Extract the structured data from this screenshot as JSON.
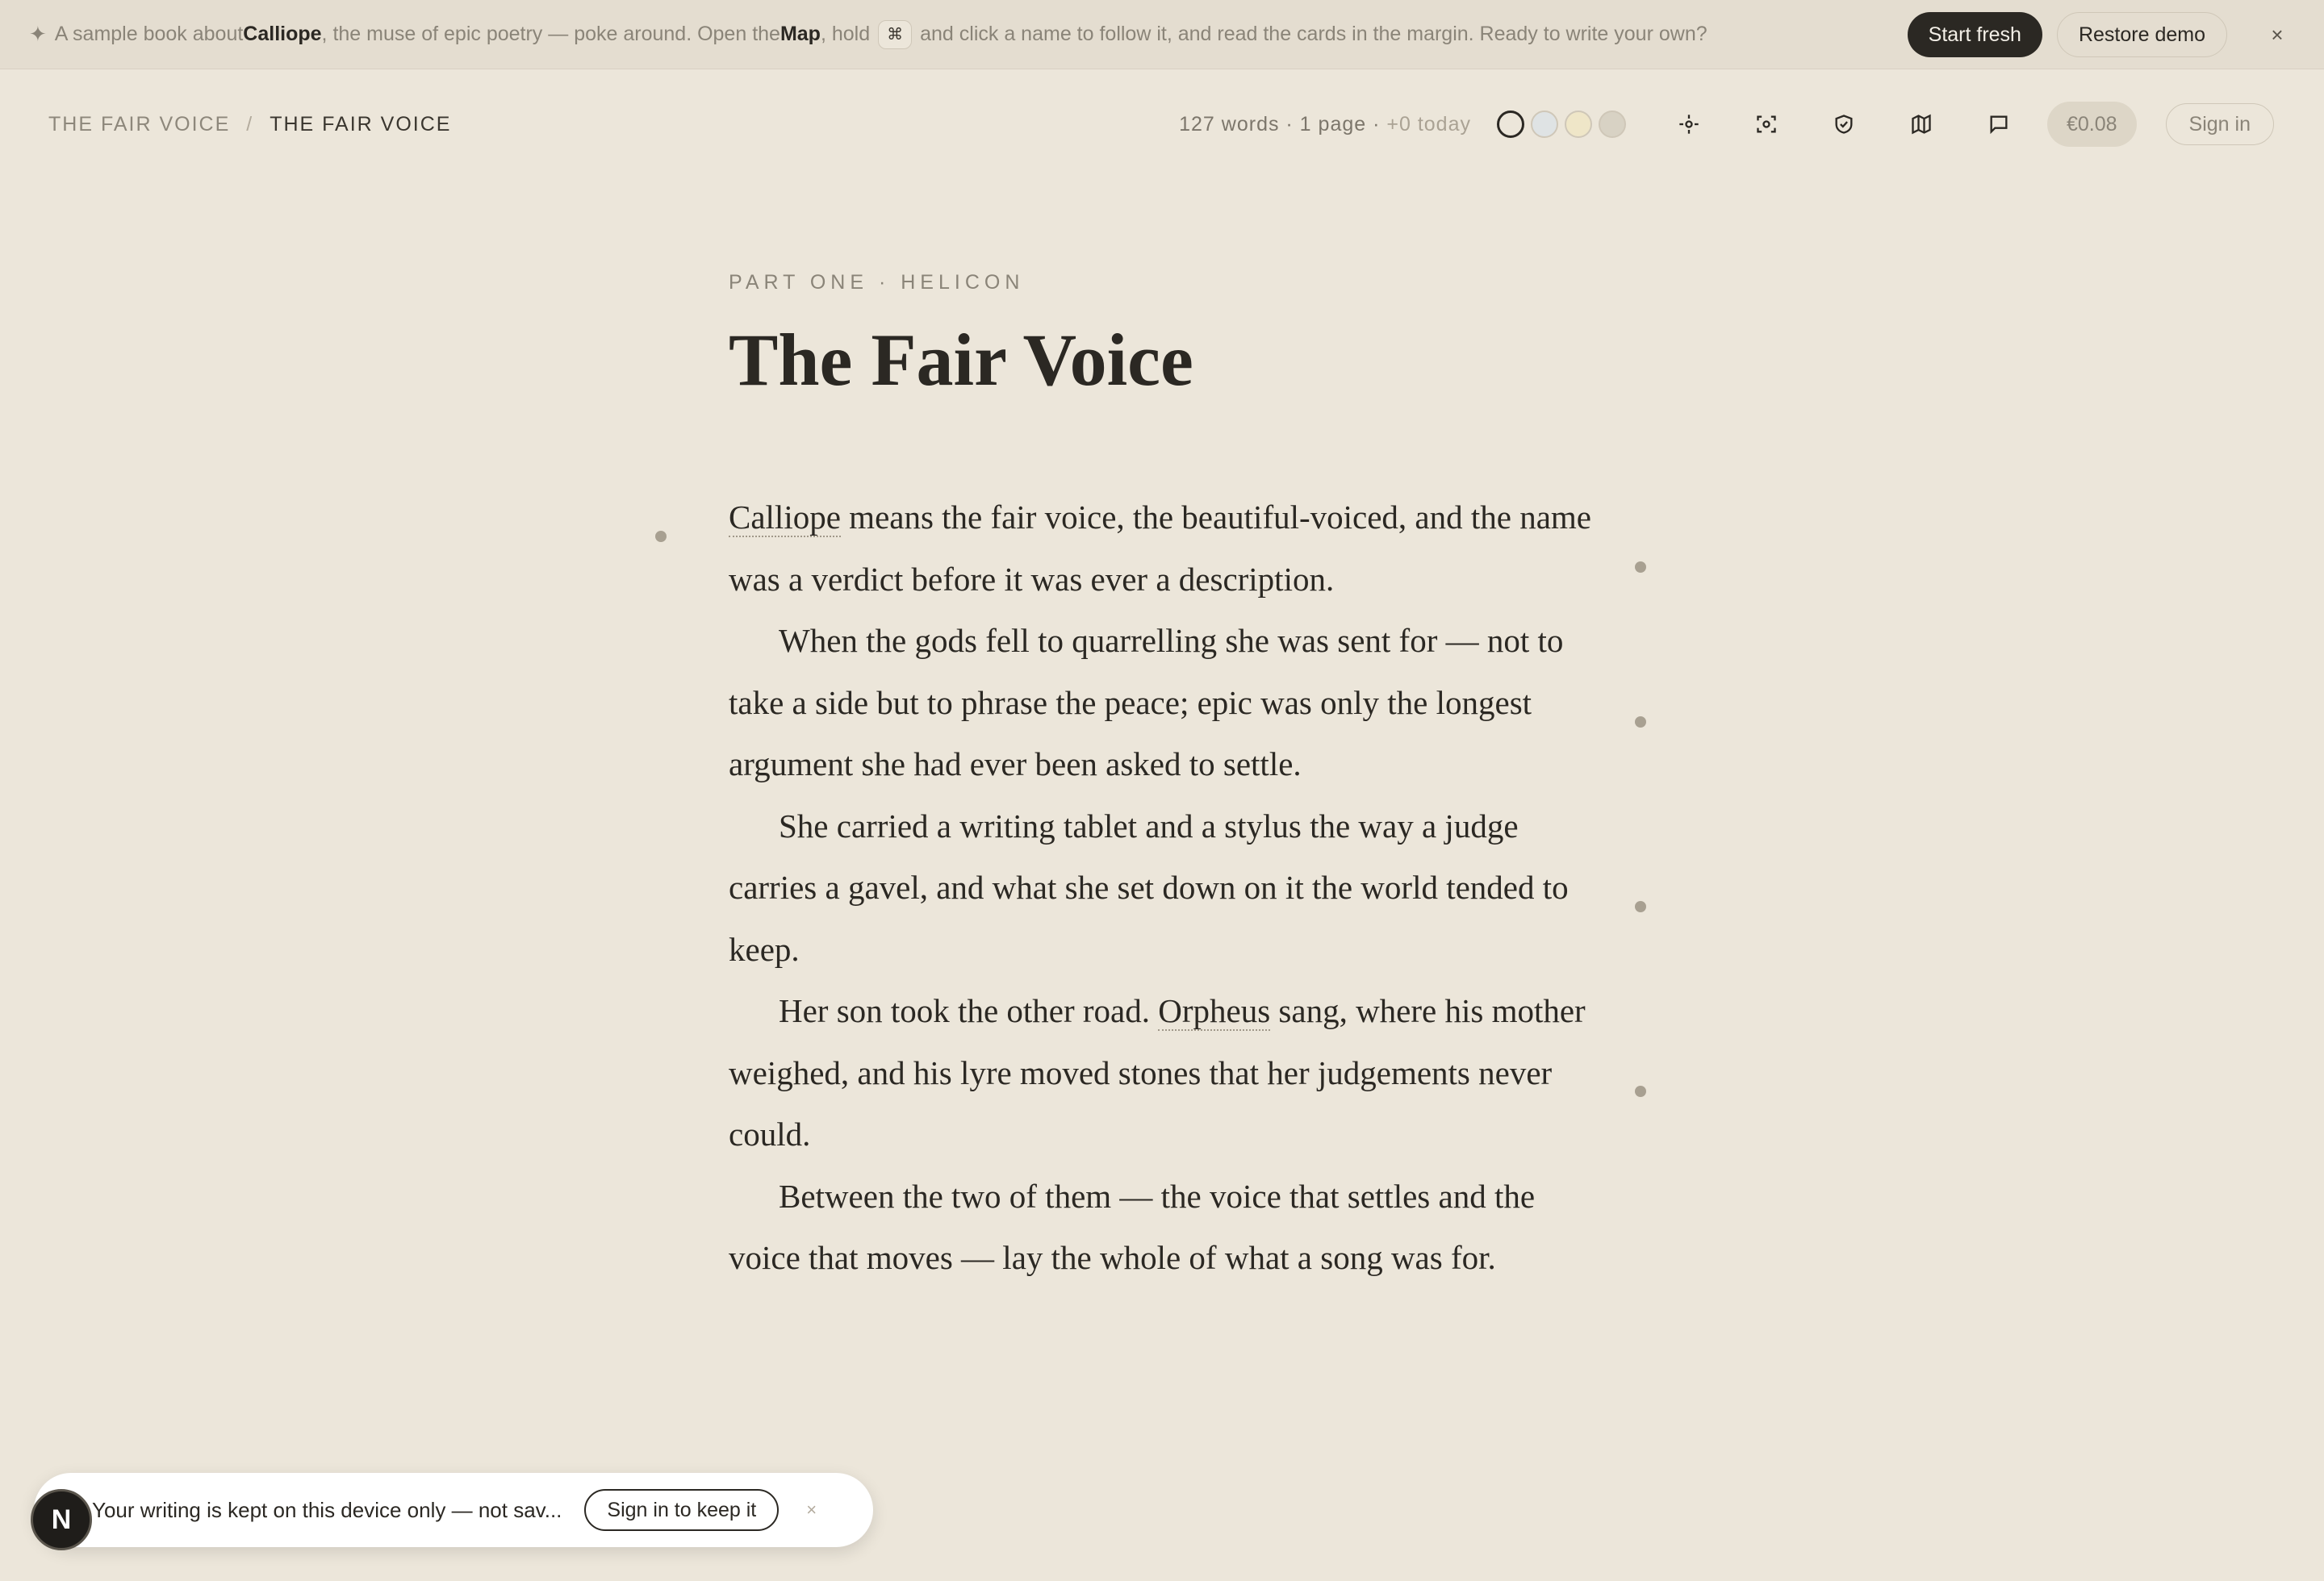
{
  "banner": {
    "sparkle": "✦",
    "text_1": "A sample book about ",
    "bold_1": "Calliope",
    "text_2": ", the muse of epic poetry — poke around. Open the ",
    "bold_2": "Map",
    "text_3": ", hold ",
    "key": "⌘",
    "text_4": " and click a name to follow it, and read the cards in the margin. Ready to write your own?",
    "start_fresh": "Start fresh",
    "restore_demo": "Restore demo",
    "close": "×"
  },
  "header": {
    "crumb_1": "The Fair Voice",
    "crumb_sep": "/",
    "crumb_2": "The Fair Voice",
    "stats": "127 words · 1 page · ",
    "stats_today": "+0 today",
    "swatches": [
      "#ece6da",
      "#dfe3e4",
      "#efe6c8",
      "#d8d2c4"
    ],
    "icons": [
      "focus-icon",
      "capture-icon",
      "shield-icon",
      "map-icon",
      "comment-icon"
    ],
    "price": "€0.08",
    "sign_in": "Sign in"
  },
  "doc": {
    "part": "Part One · Helicon",
    "title": "The Fair Voice",
    "p1_link": "Calliope",
    "p1_rest": " means the fair voice, the beautiful-voiced, and the name was a verdict before it was ever a description.",
    "p2": "When the gods fell to quarrelling she was sent for — not to take a side but to phrase the peace; epic was only the longest argument she had ever been asked to settle.",
    "p3": "She carried a writing tablet and a stylus the way a judge carries a gavel, and what she set down on it the world tended to keep.",
    "p4_a": "Her son took the other road. ",
    "p4_link": "Orpheus",
    "p4_b": " sang, where his mother weighed, and his lyre moved stones that her judgements never could.",
    "p5": "Between the two of them — the voice that settles and the voice that moves — lay the whole of what a song was for."
  },
  "toast": {
    "avatar": "N",
    "text": "Your writing is kept on this device only — not sav...",
    "button": "Sign in to keep it",
    "close": "×"
  }
}
